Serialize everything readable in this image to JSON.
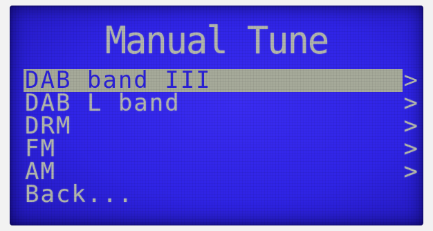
{
  "screen": {
    "title": "Manual Tune",
    "menu": [
      {
        "label": "DAB band III",
        "chevron": ">",
        "selected": true
      },
      {
        "label": "DAB L band",
        "chevron": ">"
      },
      {
        "label": "DRM",
        "chevron": ">"
      },
      {
        "label": "FM",
        "chevron": ">"
      },
      {
        "label": "AM",
        "chevron": ">"
      },
      {
        "label": "Back...",
        "chevron": ""
      }
    ]
  },
  "colors": {
    "lcd_background": "#2f24e6",
    "lcd_text": "#b3b7ad",
    "selection_highlight": "#a6aa9a"
  }
}
